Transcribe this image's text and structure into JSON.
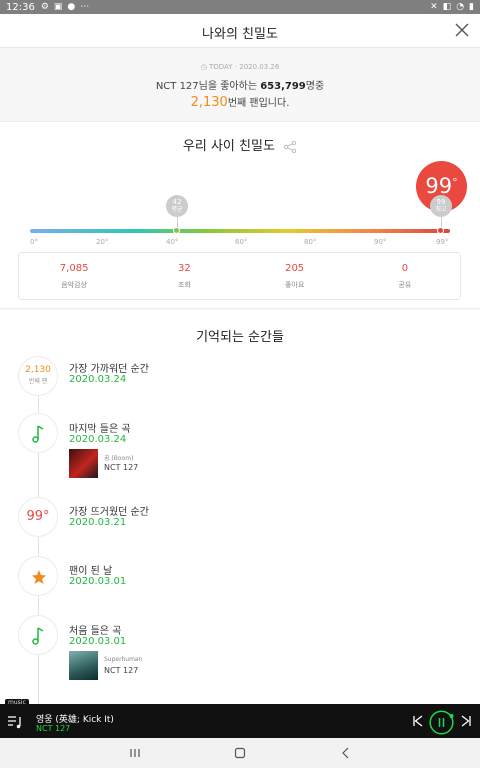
{
  "status_bar": {
    "time": "12:36"
  },
  "header": {
    "title": "나와의 친밀도"
  },
  "summary": {
    "today": "TODAY · 2020.03.26",
    "line1_prefix": "NCT 127님을 좋아하는 ",
    "fan_count": "653,799",
    "line1_suffix": "명중",
    "rank": "2,130",
    "line2_suffix": "번째 팬입니다."
  },
  "closeness": {
    "title": "우리 사이 친밀도",
    "score": "99",
    "score_unit": "°",
    "gauge_level": 99,
    "avg_marker": {
      "value": "42",
      "label": "평균"
    },
    "top_marker": {
      "value": "99",
      "label": "최고"
    },
    "ticks": [
      "0°",
      "20°",
      "40°",
      "60°",
      "80°",
      "90°",
      "99°"
    ],
    "stats": [
      {
        "value": "7,085",
        "label": "음악감상"
      },
      {
        "value": "32",
        "label": "조회"
      },
      {
        "value": "205",
        "label": "좋아요"
      },
      {
        "value": "0",
        "label": "공유"
      }
    ],
    "colors": {
      "accent": "#e9493f",
      "orange": "#f08a1d",
      "green": "#1fb83f"
    }
  },
  "moments": {
    "title": "기억되는 순간들",
    "items": [
      {
        "badge_value": "2,130",
        "badge_label": "번째 팬",
        "title": "가장 가까워던 순간",
        "date": "2020.03.24"
      },
      {
        "icon": "music-note-icon",
        "title": "마지막 들은 곡",
        "date": "2020.03.24",
        "song": "꿈 (Boom)",
        "artist": "NCT 127"
      },
      {
        "badge_value": "99°",
        "title": "가장 뜨거웠던 순간",
        "date": "2020.03.21"
      },
      {
        "icon": "star-icon",
        "title": "팬이 된 날",
        "date": "2020.03.01"
      },
      {
        "icon": "music-note-icon",
        "title": "처음 들은 곡",
        "date": "2020.03.01",
        "song": "Superhuman",
        "artist": "NCT 127"
      }
    ]
  },
  "player": {
    "tag": "music",
    "song": "영웅 (英雄; Kick It)",
    "artist": "NCT 127"
  }
}
